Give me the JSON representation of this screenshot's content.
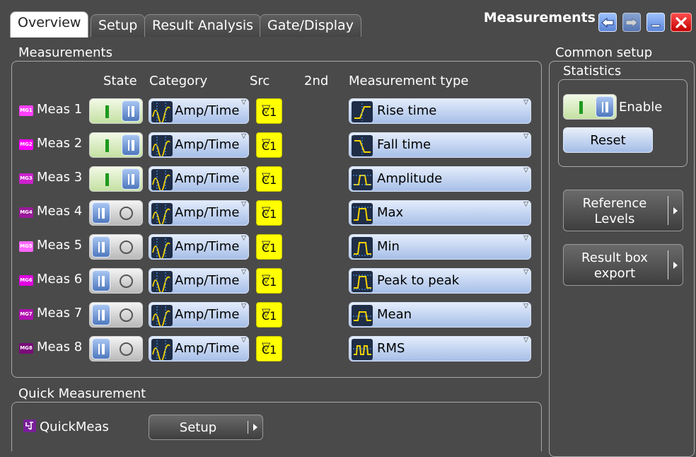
{
  "tabs": [
    {
      "label": "Overview",
      "active": true
    },
    {
      "label": "Setup",
      "active": false
    },
    {
      "label": "Result Analysis",
      "active": false
    },
    {
      "label": "Gate/Display",
      "active": false
    }
  ],
  "window": {
    "title": "Measurements"
  },
  "measurements_section": {
    "title": "Measurements",
    "headers": {
      "state": "State",
      "category": "Category",
      "src": "Src",
      "second": "2nd",
      "type": "Measurement type"
    }
  },
  "rows": [
    {
      "icon": "MG1",
      "label": "Meas 1",
      "state": "on",
      "category": "Amp/Time",
      "src": "C1",
      "type": "Rise time",
      "icon_color": "#ff40ff"
    },
    {
      "icon": "MG2",
      "label": "Meas 2",
      "state": "on",
      "category": "Amp/Time",
      "src": "C1",
      "type": "Fall time",
      "icon_color": "#ff00ff"
    },
    {
      "icon": "MG3",
      "label": "Meas 3",
      "state": "on",
      "category": "Amp/Time",
      "src": "C1",
      "type": "Amplitude",
      "icon_color": "#cc22cc"
    },
    {
      "icon": "MG4",
      "label": "Meas 4",
      "state": "off",
      "category": "Amp/Time",
      "src": "C1",
      "type": "Max",
      "icon_color": "#9a1a9a"
    },
    {
      "icon": "MG5",
      "label": "Meas 5",
      "state": "off",
      "category": "Amp/Time",
      "src": "C1",
      "type": "Min",
      "icon_color": "#ff66ff"
    },
    {
      "icon": "MG6",
      "label": "Meas 6",
      "state": "off",
      "category": "Amp/Time",
      "src": "C1",
      "type": "Peak to peak",
      "icon_color": "#e000e0"
    },
    {
      "icon": "MG7",
      "label": "Meas 7",
      "state": "off",
      "category": "Amp/Time",
      "src": "C1",
      "type": "Mean",
      "icon_color": "#b010b0"
    },
    {
      "icon": "MG8",
      "label": "Meas 8",
      "state": "off",
      "category": "Amp/Time",
      "src": "C1",
      "type": "RMS",
      "icon_color": "#7a0a7a"
    }
  ],
  "quick_section": {
    "title": "Quick Measurement",
    "label": "QuickMeas",
    "setup_button": "Setup"
  },
  "common_setup": {
    "title": "Common setup",
    "statistics_title": "Statistics",
    "enable_label": "Enable",
    "reset_button": "Reset",
    "reference_levels_line1": "Reference",
    "reference_levels_line2": "Levels",
    "result_box_line1": "Result box",
    "result_box_line2": "export"
  },
  "colors": {
    "background": "#4a4a4a",
    "src_yellow": "#ffff00",
    "toggle_on": "#c4e0a2",
    "knob_blue": "#4f78bd",
    "close_red": "#e60000"
  }
}
